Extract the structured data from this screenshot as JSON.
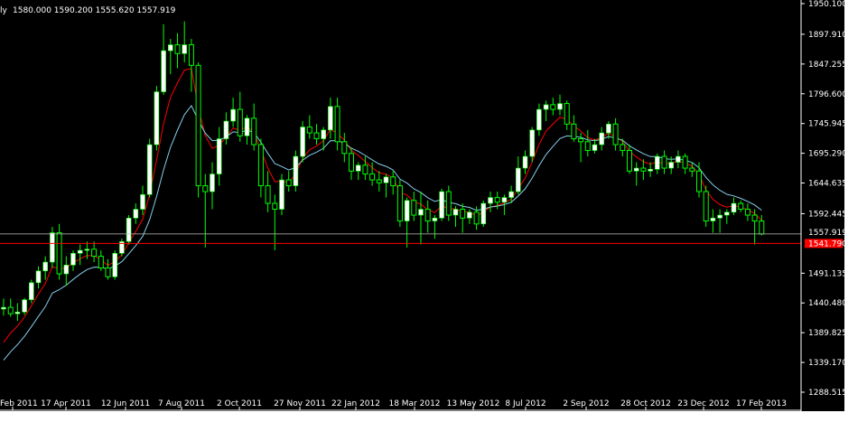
{
  "window": {
    "header_prefix": "ly",
    "ohlc_values": "1580.000 1590.200 1555.620 1557.919"
  },
  "colors": {
    "background": "#000000",
    "bull_candle": "#ffffff",
    "candle_wick": "#00ff00",
    "fast_ma": "#ff0000",
    "slow_ma": "#87ceeb",
    "horizontal_line": "#ff0000",
    "bid_line": "#c0c0c0",
    "axis_text": "#ffffff"
  },
  "price_axis": {
    "ticks": [
      "1950.100",
      "1897.910",
      "1847.255",
      "1796.600",
      "1745.945",
      "1695.290",
      "1644.635",
      "1592.445",
      "1541.790",
      "1491.135",
      "1440.480",
      "1389.825",
      "1339.170",
      "1288.515"
    ],
    "current_price_label": "1557.919",
    "line_label": "1541.790"
  },
  "time_axis": {
    "ticks": [
      "Feb 2011",
      "17 Apr 2011",
      "12 Jun 2011",
      "7 Aug 2011",
      "2 Oct 2011",
      "27 Nov 2011",
      "22 Jan 2012",
      "18 Mar 2012",
      "13 May 2012",
      "8 Jul 2012",
      "2 Sep 2012",
      "28 Oct 2012",
      "23 Dec 2012",
      "17 Feb 2013"
    ]
  },
  "chart_data": {
    "type": "candlestick",
    "timeframe": "weekly",
    "x_start": "13 Feb 2011",
    "candles": [
      [
        1430,
        1448,
        1419,
        1433
      ],
      [
        1433,
        1448,
        1417,
        1422
      ],
      [
        1422,
        1440,
        1410,
        1425
      ],
      [
        1425,
        1449,
        1420,
        1446
      ],
      [
        1446,
        1480,
        1440,
        1475
      ],
      [
        1475,
        1503,
        1465,
        1495
      ],
      [
        1495,
        1520,
        1480,
        1510
      ],
      [
        1510,
        1570,
        1500,
        1560
      ],
      [
        1560,
        1575,
        1480,
        1490
      ],
      [
        1490,
        1520,
        1470,
        1505
      ],
      [
        1505,
        1530,
        1495,
        1525
      ],
      [
        1525,
        1540,
        1505,
        1530
      ],
      [
        1530,
        1545,
        1515,
        1532
      ],
      [
        1532,
        1545,
        1510,
        1520
      ],
      [
        1520,
        1530,
        1495,
        1500
      ],
      [
        1500,
        1515,
        1480,
        1485
      ],
      [
        1485,
        1530,
        1480,
        1525
      ],
      [
        1525,
        1550,
        1520,
        1545
      ],
      [
        1545,
        1590,
        1540,
        1585
      ],
      [
        1585,
        1610,
        1575,
        1600
      ],
      [
        1600,
        1640,
        1590,
        1625
      ],
      [
        1625,
        1720,
        1620,
        1710
      ],
      [
        1710,
        1810,
        1700,
        1800
      ],
      [
        1800,
        1915,
        1795,
        1870
      ],
      [
        1870,
        1890,
        1830,
        1880
      ],
      [
        1880,
        1900,
        1840,
        1865
      ],
      [
        1865,
        1920,
        1850,
        1880
      ],
      [
        1880,
        1890,
        1800,
        1845
      ],
      [
        1845,
        1850,
        1620,
        1640
      ],
      [
        1640,
        1660,
        1535,
        1630
      ],
      [
        1630,
        1680,
        1600,
        1660
      ],
      [
        1660,
        1740,
        1640,
        1720
      ],
      [
        1720,
        1765,
        1710,
        1750
      ],
      [
        1750,
        1790,
        1740,
        1770
      ],
      [
        1770,
        1800,
        1715,
        1725
      ],
      [
        1725,
        1760,
        1710,
        1755
      ],
      [
        1755,
        1780,
        1700,
        1710
      ],
      [
        1710,
        1720,
        1620,
        1640
      ],
      [
        1640,
        1665,
        1595,
        1610
      ],
      [
        1610,
        1625,
        1530,
        1600
      ],
      [
        1600,
        1660,
        1590,
        1650
      ],
      [
        1650,
        1665,
        1630,
        1640
      ],
      [
        1640,
        1700,
        1630,
        1690
      ],
      [
        1690,
        1750,
        1680,
        1740
      ],
      [
        1740,
        1760,
        1720,
        1730
      ],
      [
        1730,
        1745,
        1710,
        1720
      ],
      [
        1720,
        1740,
        1700,
        1735
      ],
      [
        1735,
        1790,
        1720,
        1775
      ],
      [
        1775,
        1790,
        1700,
        1715
      ],
      [
        1715,
        1730,
        1680,
        1695
      ],
      [
        1695,
        1705,
        1650,
        1665
      ],
      [
        1665,
        1680,
        1650,
        1675
      ],
      [
        1675,
        1690,
        1650,
        1660
      ],
      [
        1660,
        1680,
        1640,
        1650
      ],
      [
        1650,
        1665,
        1630,
        1645
      ],
      [
        1645,
        1660,
        1620,
        1655
      ],
      [
        1655,
        1665,
        1625,
        1640
      ],
      [
        1640,
        1650,
        1570,
        1580
      ],
      [
        1580,
        1620,
        1535,
        1615
      ],
      [
        1615,
        1630,
        1580,
        1590
      ],
      [
        1590,
        1630,
        1540,
        1600
      ],
      [
        1600,
        1615,
        1560,
        1580
      ],
      [
        1580,
        1590,
        1550,
        1585
      ],
      [
        1585,
        1635,
        1580,
        1630
      ],
      [
        1630,
        1640,
        1580,
        1590
      ],
      [
        1590,
        1605,
        1570,
        1600
      ],
      [
        1600,
        1610,
        1560,
        1585
      ],
      [
        1585,
        1600,
        1575,
        1595
      ],
      [
        1595,
        1605,
        1565,
        1575
      ],
      [
        1575,
        1615,
        1570,
        1610
      ],
      [
        1610,
        1630,
        1595,
        1620
      ],
      [
        1620,
        1630,
        1600,
        1612
      ],
      [
        1612,
        1625,
        1590,
        1620
      ],
      [
        1620,
        1640,
        1610,
        1630
      ],
      [
        1630,
        1690,
        1625,
        1670
      ],
      [
        1670,
        1700,
        1660,
        1690
      ],
      [
        1690,
        1740,
        1680,
        1735
      ],
      [
        1735,
        1780,
        1725,
        1770
      ],
      [
        1770,
        1785,
        1750,
        1778
      ],
      [
        1778,
        1790,
        1760,
        1770
      ],
      [
        1770,
        1795,
        1760,
        1780
      ],
      [
        1780,
        1785,
        1735,
        1745
      ],
      [
        1745,
        1760,
        1715,
        1720
      ],
      [
        1720,
        1730,
        1680,
        1715
      ],
      [
        1715,
        1735,
        1690,
        1700
      ],
      [
        1700,
        1720,
        1695,
        1710
      ],
      [
        1710,
        1740,
        1700,
        1730
      ],
      [
        1730,
        1750,
        1720,
        1745
      ],
      [
        1745,
        1755,
        1700,
        1710
      ],
      [
        1710,
        1720,
        1690,
        1700
      ],
      [
        1700,
        1710,
        1660,
        1665
      ],
      [
        1665,
        1680,
        1640,
        1670
      ],
      [
        1670,
        1685,
        1650,
        1665
      ],
      [
        1665,
        1680,
        1655,
        1668
      ],
      [
        1668,
        1695,
        1660,
        1690
      ],
      [
        1690,
        1700,
        1660,
        1670
      ],
      [
        1670,
        1690,
        1660,
        1680
      ],
      [
        1680,
        1700,
        1670,
        1690
      ],
      [
        1690,
        1695,
        1660,
        1670
      ],
      [
        1670,
        1680,
        1655,
        1665
      ],
      [
        1665,
        1680,
        1620,
        1630
      ],
      [
        1630,
        1640,
        1570,
        1580
      ],
      [
        1580,
        1600,
        1560,
        1585
      ],
      [
        1585,
        1600,
        1560,
        1590
      ],
      [
        1590,
        1600,
        1575,
        1595
      ],
      [
        1595,
        1620,
        1590,
        1610
      ],
      [
        1610,
        1615,
        1595,
        1600
      ],
      [
        1600,
        1610,
        1580,
        1590
      ],
      [
        1590,
        1600,
        1540,
        1580
      ],
      [
        1580,
        1590.2,
        1555.62,
        1557.919
      ]
    ],
    "moving_averages": [
      {
        "color": "#ff0000",
        "period_hint": "fast"
      },
      {
        "color": "#87ceeb",
        "period_hint": "slow"
      }
    ],
    "horizontal_line_price": 1541.79,
    "current_price": 1557.919,
    "y_range": [
      1288.515,
      1950.1
    ]
  }
}
